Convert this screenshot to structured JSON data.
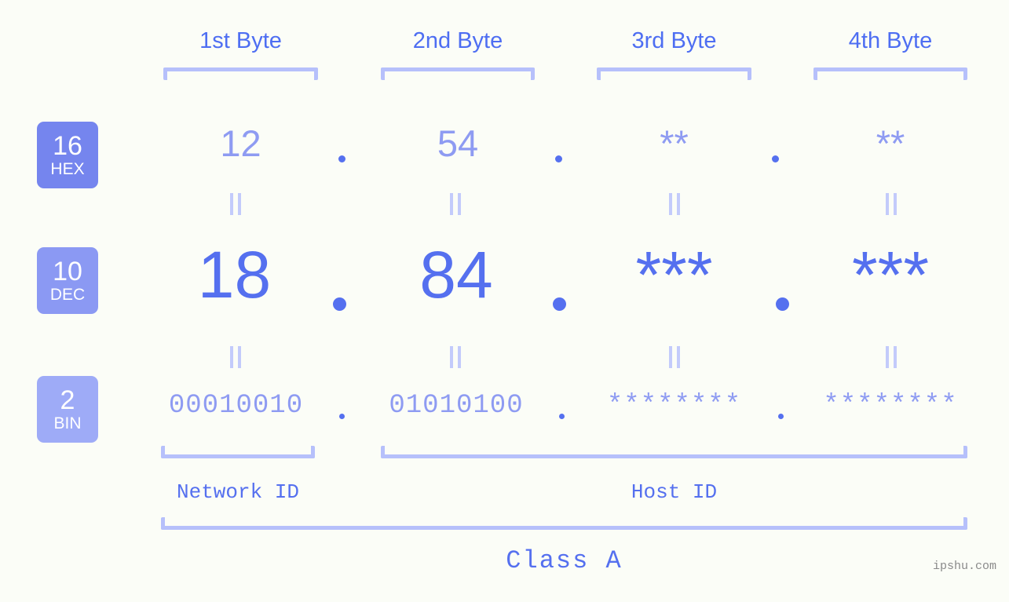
{
  "background_color": "#fbfdf7",
  "colors": {
    "accent_strong": "#5570ef",
    "accent_mid": "#8e9bf2",
    "bracket": "#b6c0fb",
    "badge_hex": "#7585ee",
    "badge_dec": "#8b99f3",
    "badge_bin": "#9eabf7",
    "equals_mark": "#c3cbfb",
    "watermark": "#8a8a8a"
  },
  "byte_headers": [
    {
      "label": "1st Byte"
    },
    {
      "label": "2nd Byte"
    },
    {
      "label": "3rd Byte"
    },
    {
      "label": "4th Byte"
    }
  ],
  "bases": [
    {
      "number": "16",
      "system": "HEX"
    },
    {
      "number": "10",
      "system": "DEC"
    },
    {
      "number": "2",
      "system": "BIN"
    }
  ],
  "rows": {
    "hex": {
      "octets": [
        "12",
        "54",
        "**",
        "**"
      ],
      "separator": "."
    },
    "dec": {
      "octets": [
        "18",
        "84",
        "***",
        "***"
      ],
      "separator": "."
    },
    "bin": {
      "octets": [
        "00010010",
        "01010100",
        "********",
        "********"
      ],
      "separator": "."
    }
  },
  "equality_symbol": "||",
  "id_segments": [
    {
      "label": "Network ID"
    },
    {
      "label": "Host ID"
    }
  ],
  "class": {
    "label": "Class A"
  },
  "watermark": {
    "text": "ipshu.com"
  }
}
